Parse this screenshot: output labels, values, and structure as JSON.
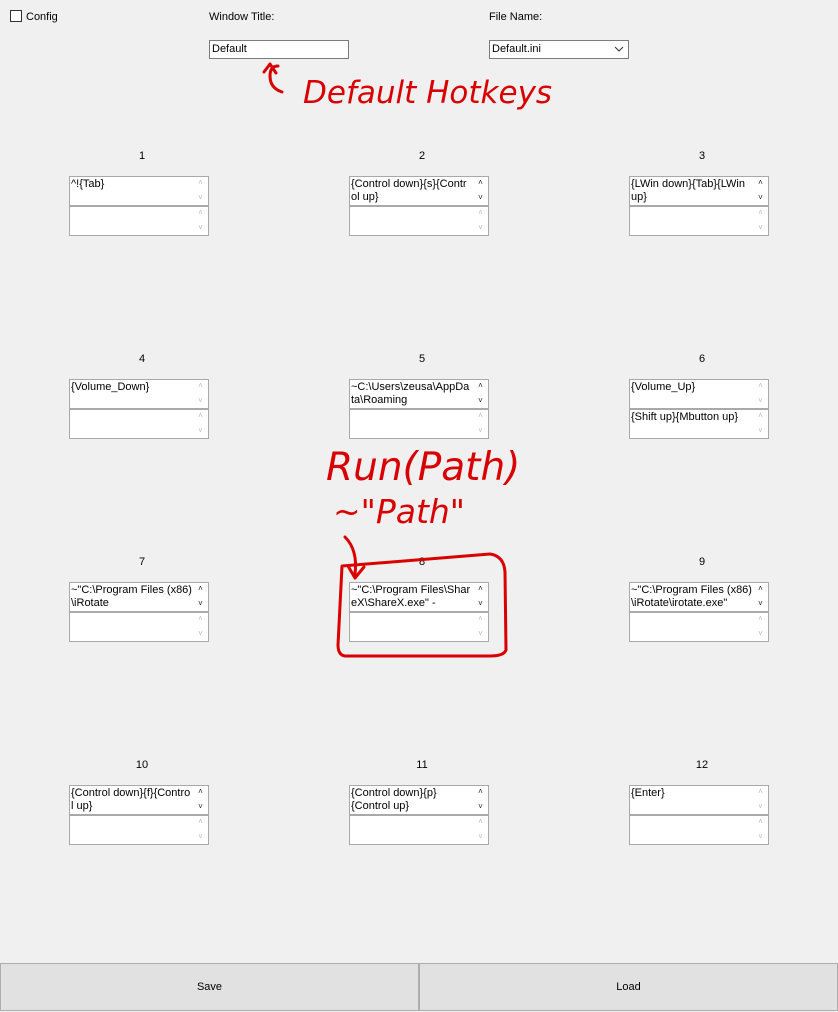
{
  "config": {
    "label": "Config",
    "checked": false
  },
  "window_title": {
    "label": "Window Title:",
    "value": "Default"
  },
  "file_name": {
    "label": "File Name:",
    "value": "Default.ini"
  },
  "hotkeys": [
    {
      "number": "1",
      "primary": "^!{Tab}",
      "secondary": ""
    },
    {
      "number": "2",
      "primary": "{Control down}{s}{Control up}",
      "secondary": ""
    },
    {
      "number": "3",
      "primary": "{LWin down}{Tab}{LWin up}",
      "secondary": ""
    },
    {
      "number": "4",
      "primary": "{Volume_Down}",
      "secondary": ""
    },
    {
      "number": "5",
      "primary": "~C:\\Users\\zeusa\\AppData\\Roaming",
      "secondary": ""
    },
    {
      "number": "6",
      "primary": "{Volume_Up}",
      "secondary": "{Shift up}{Mbutton up}"
    },
    {
      "number": "7",
      "primary": "~\"C:\\Program Files (x86)\\iRotate",
      "secondary": ""
    },
    {
      "number": "8",
      "primary": "~\"C:\\Program Files\\ShareX\\ShareX.exe\" -",
      "secondary": ""
    },
    {
      "number": "9",
      "primary": "~\"C:\\Program Files (x86)\\iRotate\\irotate.exe\"",
      "secondary": ""
    },
    {
      "number": "10",
      "primary": "{Control down}{f}{Control up}",
      "secondary": ""
    },
    {
      "number": "11",
      "primary": "{Control down}{p}\n{Control up}",
      "secondary": ""
    },
    {
      "number": "12",
      "primary": "{Enter}",
      "secondary": ""
    }
  ],
  "buttons": {
    "save": "Save",
    "load": "Load"
  },
  "annotations": {
    "default_hotkeys": "Default   Hotkeys",
    "run_path": "Run(Path)",
    "tilde_path": "~\"Path\"",
    "ink_color": "#d90000"
  }
}
